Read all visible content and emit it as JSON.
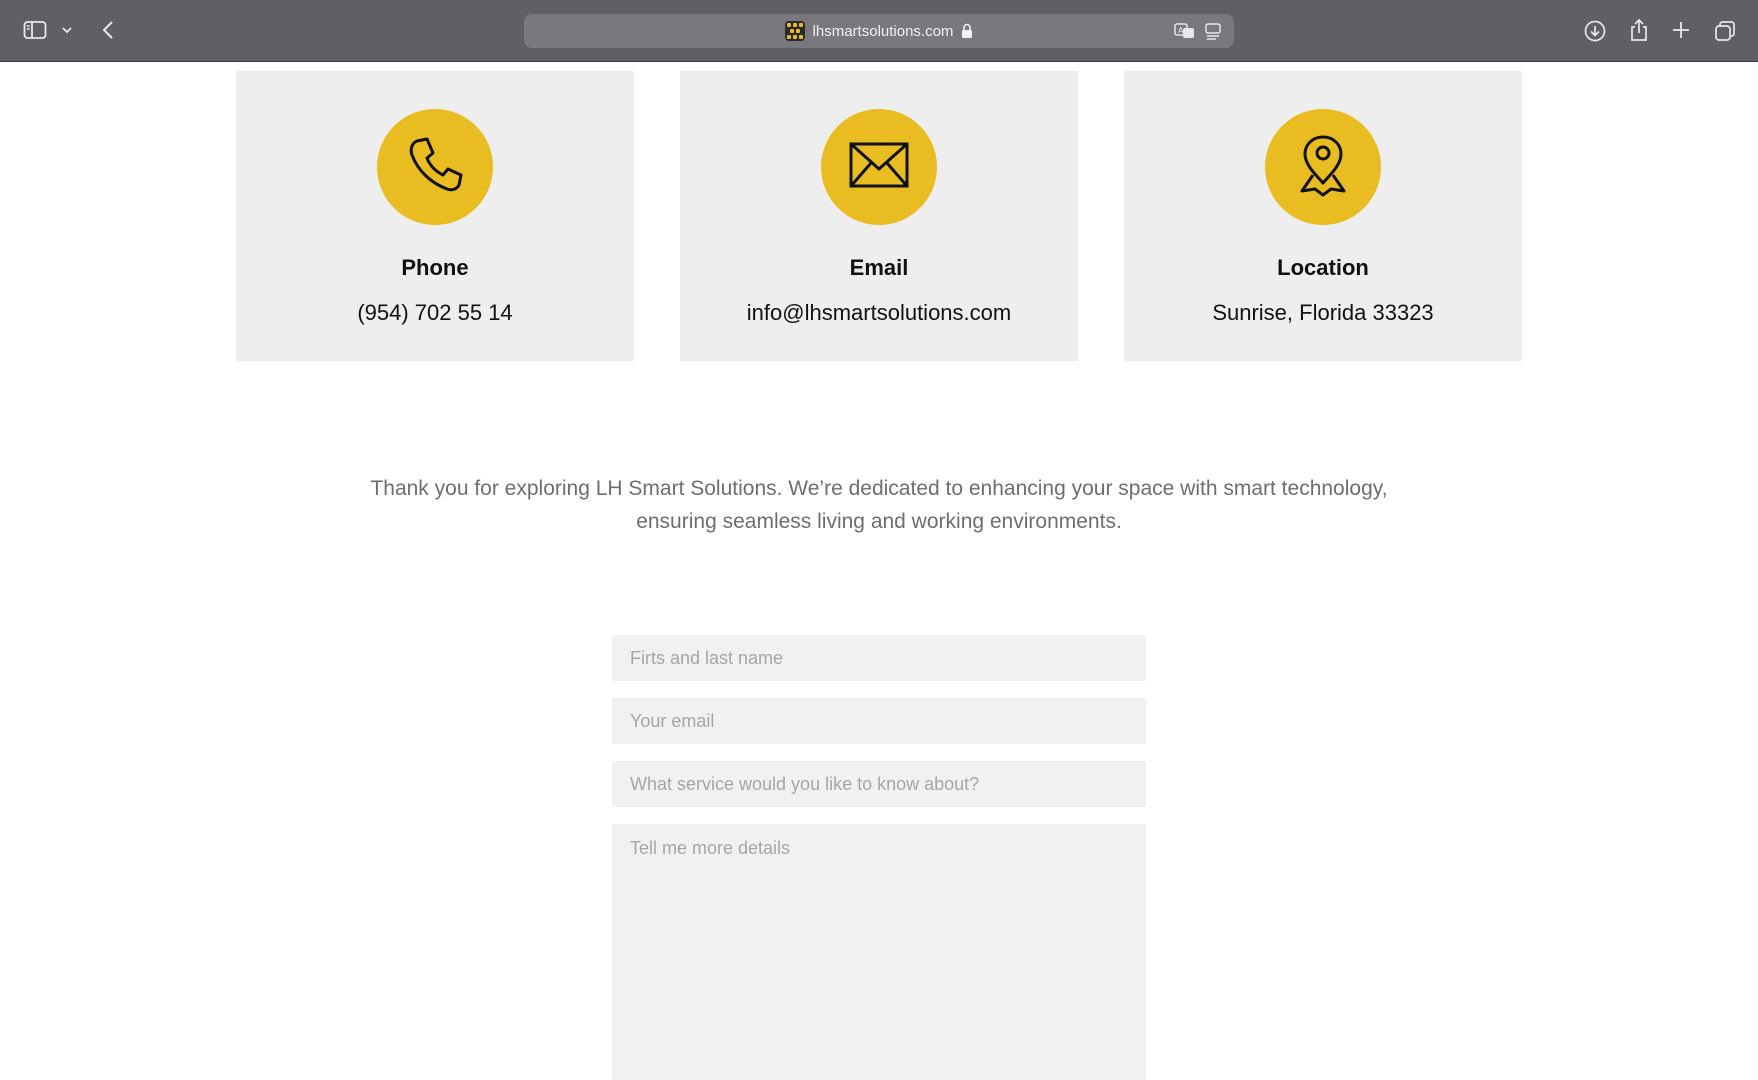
{
  "browser": {
    "url": "lhsmartsolutions.com"
  },
  "contact_cards": [
    {
      "icon": "phone-icon",
      "title": "Phone",
      "value": "(954) 702 55 14"
    },
    {
      "icon": "envelope-icon",
      "title": "Email",
      "value": "info@lhsmartsolutions.com"
    },
    {
      "icon": "location-pin-icon",
      "title": "Location",
      "value": "Sunrise, Florida 33323"
    }
  ],
  "intro": {
    "line1": "Thank you for exploring LH Smart Solutions. We’re dedicated to enhancing your space with smart technology,",
    "line2": "ensuring seamless living and working environments."
  },
  "form": {
    "name_placeholder": "Firts and last name",
    "email_placeholder": "Your email",
    "service_placeholder": "What service would you like to know about?",
    "details_placeholder": "Tell me more details"
  },
  "colors": {
    "accent": "#e9bd22",
    "card_bg": "#eeeeee",
    "toolbar_bg": "#5f5f64"
  }
}
